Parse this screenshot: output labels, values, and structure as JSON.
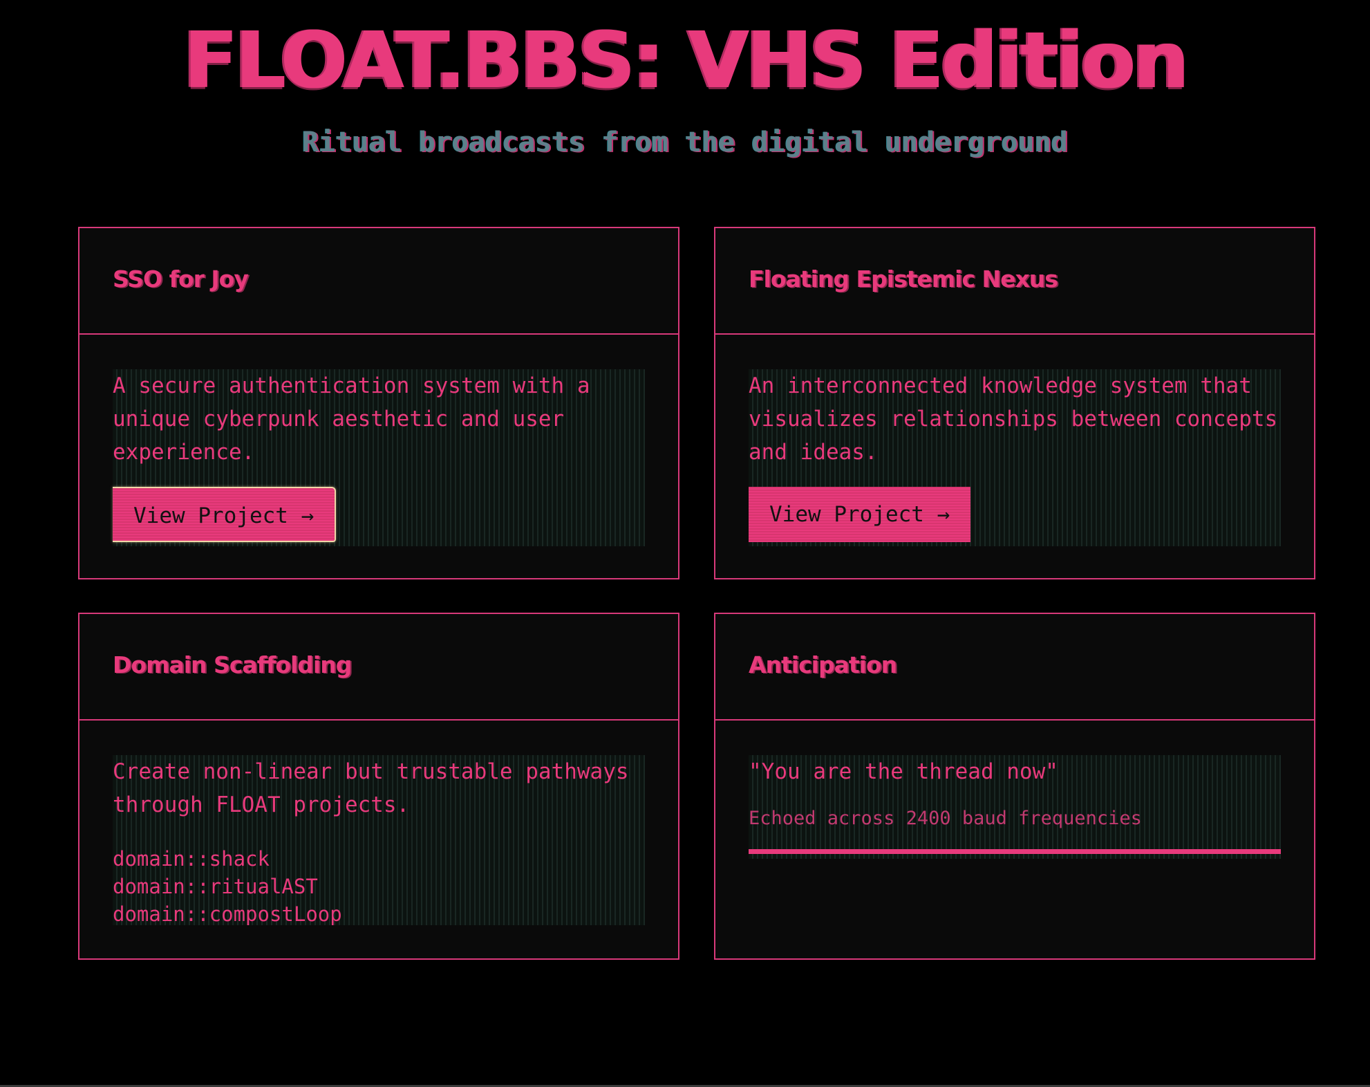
{
  "header": {
    "title": "FLOAT.BBS: VHS Edition",
    "subtitle": "Ritual broadcasts from the digital underground"
  },
  "cards": [
    {
      "title": "SSO for Joy",
      "description": "A secure authentication system with a unique cyberpunk aesthetic and user experience.",
      "button_label": "View Project →"
    },
    {
      "title": "Floating Epistemic Nexus",
      "description": "An interconnected knowledge system that visualizes relationships between concepts and ideas.",
      "button_label": "View Project →"
    },
    {
      "title": "Domain Scaffolding",
      "description": "Create non-linear but trustable pathways through FLOAT projects.",
      "domains": [
        "domain::shack",
        "domain::ritualAST",
        "domain::compostLoop"
      ]
    },
    {
      "title": "Anticipation",
      "quote": "\"You are the thread now\"",
      "caption": "Echoed across 2400 baud frequencies",
      "progress": 1.0
    }
  ],
  "colors": {
    "accent": "#e83a7c",
    "background": "#000000",
    "card_background": "#0a0a0a",
    "subtitle": "#5e7f8a"
  }
}
